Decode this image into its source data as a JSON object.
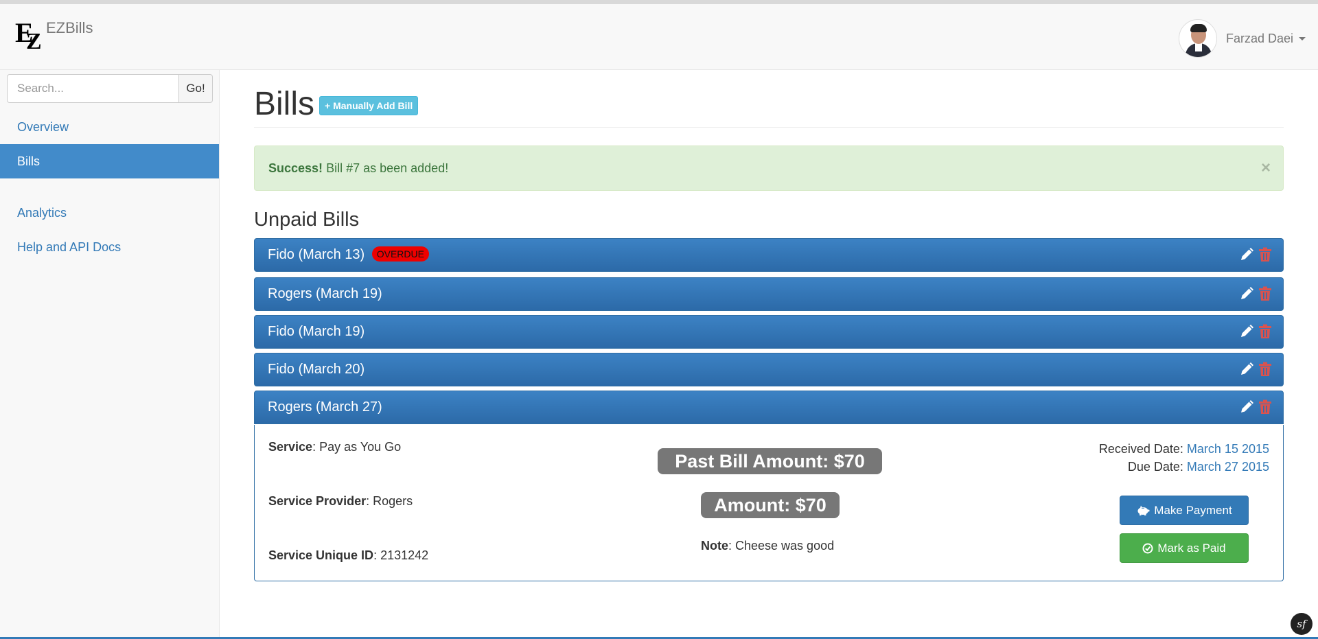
{
  "navbar": {
    "brand_initials": "EZ",
    "brand_name": "EZBills",
    "user_name": "Farzad Daei"
  },
  "sidebar": {
    "search_placeholder": "Search...",
    "search_button": "Go!",
    "items": [
      {
        "label": "Overview",
        "active": false
      },
      {
        "label": "Bills",
        "active": true
      },
      {
        "label": "Analytics",
        "active": false
      },
      {
        "label": "Help and API Docs",
        "active": false
      }
    ]
  },
  "page": {
    "title": "Bills",
    "add_button": "+ Manually Add Bill"
  },
  "alert": {
    "strong": "Success!",
    "message": " Bill #7 as been added!",
    "close": "×"
  },
  "unpaid": {
    "heading": "Unpaid Bills",
    "bills": [
      {
        "label": "Fido (March 13)",
        "badge": "OVERDUE"
      },
      {
        "label": "Rogers (March 19)"
      },
      {
        "label": "Fido (March 19)"
      },
      {
        "label": "Fido (March 20)"
      },
      {
        "label": "Rogers (March 27)",
        "expanded": true
      }
    ]
  },
  "detail": {
    "service_label": "Service",
    "service_value": ": Pay as You Go",
    "provider_label": "Service Provider",
    "provider_value": ": Rogers",
    "uid_label": "Service Unique ID",
    "uid_value": ": 2131242",
    "past_amount": "Past Bill Amount: $70",
    "amount": "Amount: $70",
    "note_label": "Note",
    "note_value": ": Cheese was good",
    "received_label": "Received Date: ",
    "received_value": "March 15 2015",
    "due_label": "Due Date: ",
    "due_value": "March 27 2015",
    "make_payment": "Make Payment",
    "mark_paid": "Mark as Paid"
  },
  "colors": {
    "panel_header": "#337ab7",
    "overdue_badge": "#ee0000",
    "trash_icon": "#d9534f",
    "success_button": "#5cb85c",
    "alert_bg": "#dff0d8"
  },
  "icons": {
    "edit": "pencil-icon",
    "delete": "trash-icon",
    "payment": "piggy-bank-icon",
    "paid": "check-circle-icon",
    "framework": "symfony-icon"
  }
}
